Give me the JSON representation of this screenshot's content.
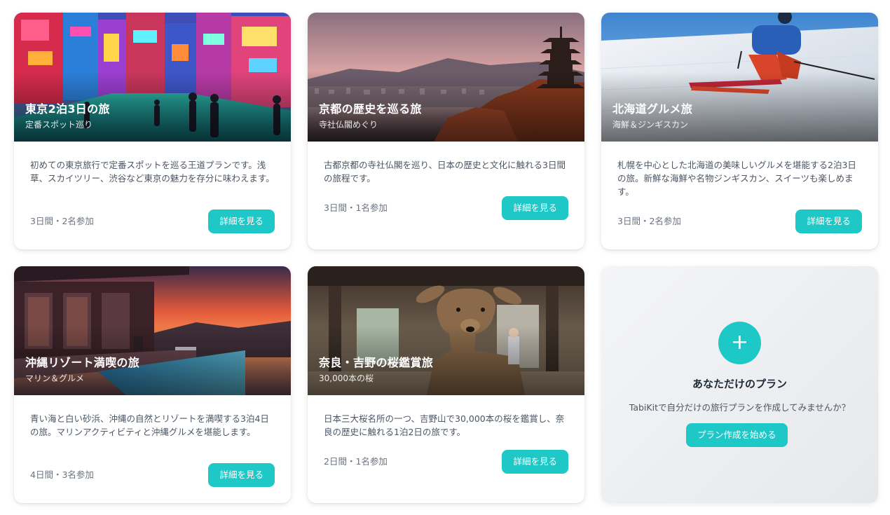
{
  "plans": [
    {
      "title": "東京2泊3日の旅",
      "subtitle": "定番スポット巡り",
      "description": "初めての東京旅行で定番スポットを巡る王道プランです。浅草、スカイツリー、渋谷など東京の魅力を存分に味わえます。",
      "meta": "3日間・2名参加",
      "button": "詳細を見る",
      "image": "tokyo-street-photo"
    },
    {
      "title": "京都の歴史を巡る旅",
      "subtitle": "寺社仏閣めぐり",
      "description": "古都京都の寺社仏閣を巡り、日本の歴史と文化に触れる3日間の旅程です。",
      "meta": "3日間・1名参加",
      "button": "詳細を見る",
      "image": "kyoto-pagoda-photo"
    },
    {
      "title": "北海道グルメ旅",
      "subtitle": "海鮮＆ジンギスカン",
      "description": "札幌を中心とした北海道の美味しいグルメを堪能する2泊3日の旅。新鮮な海鮮や名物ジンギスカン、スイーツも楽しめます。",
      "meta": "3日間・2名参加",
      "button": "詳細を見る",
      "image": "hokkaido-skier-photo"
    },
    {
      "title": "沖縄リゾート満喫の旅",
      "subtitle": "マリン＆グルメ",
      "description": "青い海と白い砂浜、沖縄の自然とリゾートを満喫する3泊4日の旅。マリンアクティビティと沖縄グルメを堪能します。",
      "meta": "4日間・3名参加",
      "button": "詳細を見る",
      "image": "okinawa-resort-sunset-photo"
    },
    {
      "title": "奈良・吉野の桜鑑賞旅",
      "subtitle": "30,000本の桜",
      "description": "日本三大桜名所の一つ、吉野山で30,000本の桜を鑑賞し、奈良の歴史に触れる1泊2日の旅です。",
      "meta": "2日間・1名参加",
      "button": "詳細を見る",
      "image": "nara-deer-photo"
    }
  ],
  "create_card": {
    "icon": "plus-icon",
    "title": "あなただけのプラン",
    "description": "TabiKitで自分だけの旅行プランを作成してみませんか？",
    "button": "プラン作成を始める"
  },
  "colors": {
    "accent": "#1ec8c6",
    "text": "#1f2937",
    "muted": "#6b7280"
  }
}
